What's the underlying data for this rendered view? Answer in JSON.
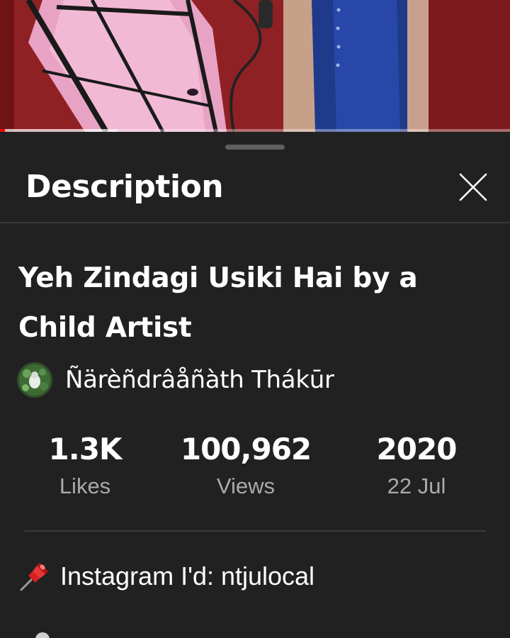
{
  "sheet": {
    "title": "Description"
  },
  "video": {
    "title": "Yeh Zindagi Usiki Hai by a Child Artist",
    "progress_fraction": 0.01,
    "buffer_fraction": 0.23
  },
  "channel": {
    "name": "Ñärèñdrâåñàth Thákūr"
  },
  "stats": [
    {
      "value": "1.3K",
      "label": "Likes"
    },
    {
      "value": "100,962",
      "label": "Views"
    },
    {
      "value": "2020",
      "label": "22 Jul"
    }
  ],
  "description": {
    "lines": [
      {
        "icon": "pushpin-icon",
        "text": "Instagram I'd: ntjulocal"
      }
    ]
  },
  "colors": {
    "sheet_background": "#212121",
    "progress_played": "#ff0000",
    "secondary_text": "#aaaaaa",
    "divider": "#3a3a3a"
  }
}
